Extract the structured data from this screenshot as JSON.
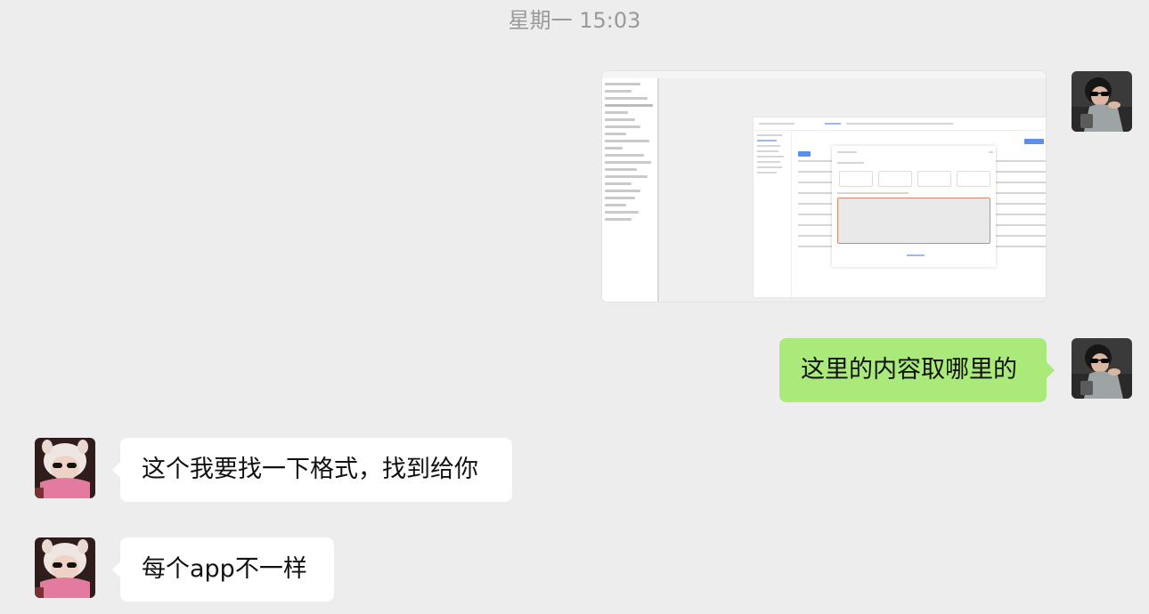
{
  "chat": {
    "timestamp": "星期一 15:03",
    "messages": [
      {
        "sender": "self",
        "type": "image",
        "description_icon": "screenshot-image"
      },
      {
        "sender": "self",
        "type": "text",
        "text": "这里的内容取哪里的"
      },
      {
        "sender": "other",
        "type": "text",
        "text": "这个我要找一下格式，找到给你"
      },
      {
        "sender": "other",
        "type": "text",
        "text": "每个app不一样"
      }
    ]
  },
  "colors": {
    "background": "#ededed",
    "self_bubble": "#a9ea7a",
    "other_bubble": "#ffffff",
    "timestamp_text": "#9a9a9a"
  }
}
